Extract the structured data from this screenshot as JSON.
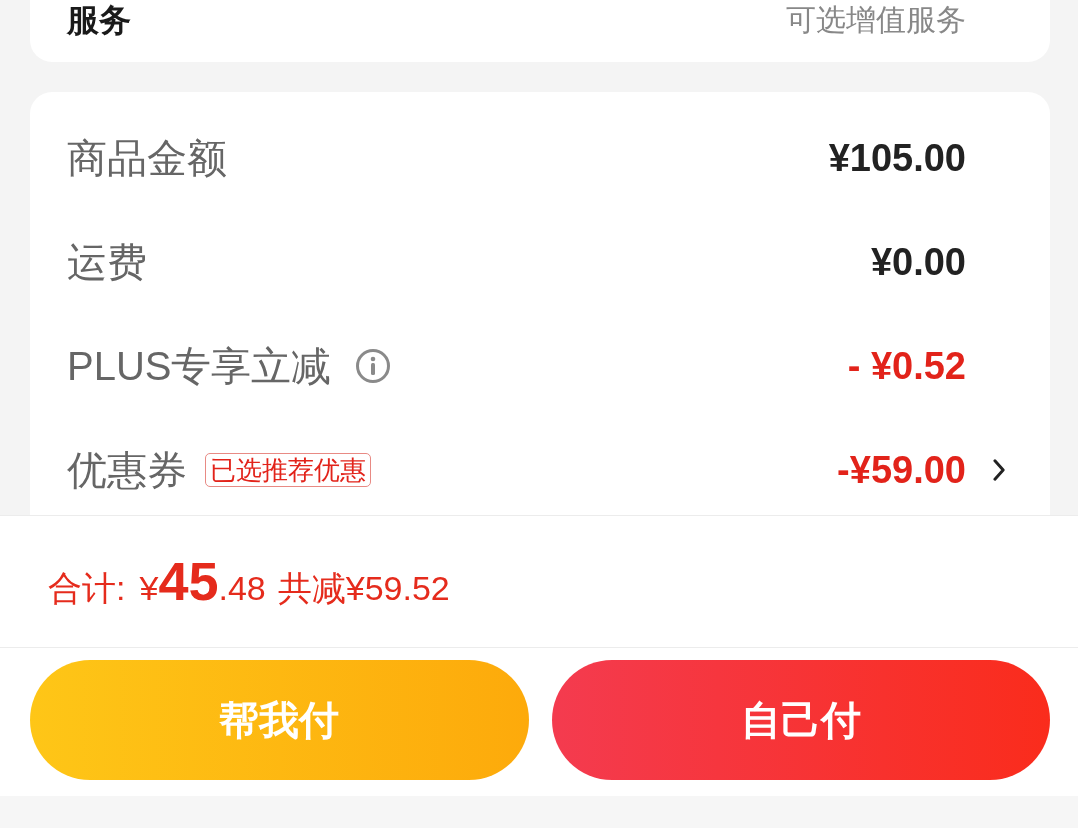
{
  "service_card": {
    "label": "服务",
    "value": "可选增值服务"
  },
  "price_rows": [
    {
      "kind": "plain",
      "label": "商品金额",
      "amount": "¥105.00",
      "discount": false
    },
    {
      "kind": "plain",
      "label": "运费",
      "amount": "¥0.00",
      "discount": false
    },
    {
      "kind": "info",
      "label": "PLUS专享立减",
      "amount": "- ¥0.52",
      "discount": true
    },
    {
      "kind": "coupon",
      "label": "优惠券",
      "tag": "已选推荐优惠",
      "amount": "-¥59.00",
      "discount": true
    }
  ],
  "summary": {
    "label": "合计:",
    "currency": "¥",
    "integer": "45",
    "decimal": ".48",
    "saving": "共减¥59.52"
  },
  "buttons": [
    {
      "kind": "secondary",
      "label": "帮我付"
    },
    {
      "kind": "primary",
      "label": "自己付"
    }
  ]
}
